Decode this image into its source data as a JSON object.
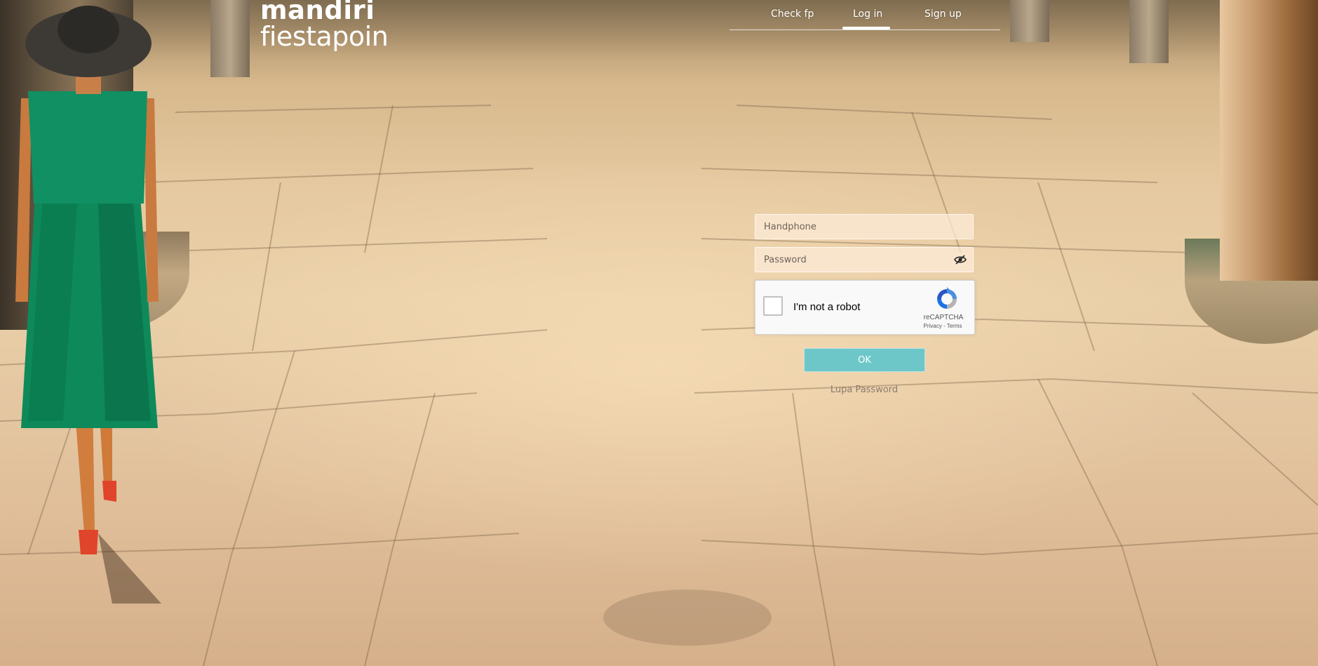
{
  "logo": {
    "line1": "mandiri",
    "line2": "fiestapoin"
  },
  "nav": {
    "items": [
      {
        "label": "Check fp"
      },
      {
        "label": "Log in",
        "active": true
      },
      {
        "label": "Sign up"
      }
    ]
  },
  "form": {
    "handphone_placeholder": "Handphone",
    "password_placeholder": "Password",
    "password_toggle_icon": "eye-slash-icon",
    "recaptcha": {
      "label": "I'm not a robot",
      "brand": "reCAPTCHA",
      "links": "Privacy - Terms"
    },
    "submit_label": "OK",
    "forgot_label": "Lupa Password"
  },
  "colors": {
    "button": "#56c4cd",
    "nav_text": "#ffffff",
    "field_bg": "#fdecda"
  }
}
